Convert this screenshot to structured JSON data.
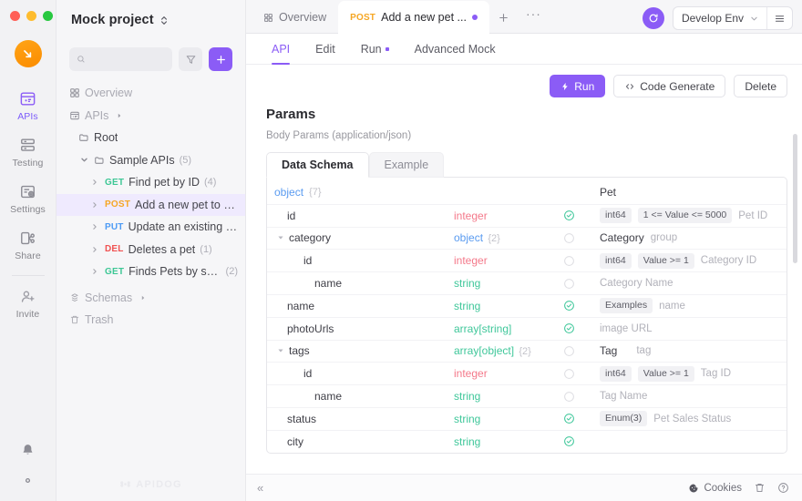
{
  "rail": {
    "brand_icon": "apidog-logo-icon",
    "items": [
      {
        "label": "APIs",
        "icon": "apis-icon",
        "active": true
      },
      {
        "label": "Testing",
        "icon": "testing-icon",
        "active": false
      },
      {
        "label": "Settings",
        "icon": "settings-icon",
        "active": false
      },
      {
        "label": "Share",
        "icon": "share-icon",
        "active": false
      },
      {
        "label": "Invite",
        "icon": "invite-icon",
        "active": false
      }
    ],
    "bottom_icons": [
      "bell-icon",
      "gear-icon"
    ]
  },
  "sidebar": {
    "project_title": "Mock project",
    "project_switcher_icon": "chevron-updown-icon",
    "search": {
      "value": "",
      "placeholder": "",
      "icon": "search-icon"
    },
    "filter_icon": "filter-icon",
    "add_label": "+",
    "overview_label": "Overview",
    "apis_label": "APIs",
    "root_label": "Root",
    "sample_apis": {
      "label": "Sample APIs",
      "count": "(5)"
    },
    "endpoints": [
      {
        "method": "GET",
        "name": "Find pet by ID",
        "count": "(4)",
        "selected": false
      },
      {
        "method": "POST",
        "name": "Add a new pet to the s...",
        "count": "",
        "selected": true
      },
      {
        "method": "PUT",
        "name": "Update an existing pet...",
        "count": "",
        "selected": false
      },
      {
        "method": "DEL",
        "name": "Deletes a pet",
        "count": "(1)",
        "selected": false
      },
      {
        "method": "GET",
        "name": "Finds Pets by status",
        "count": "(2)",
        "selected": false
      }
    ],
    "schemas_label": "Schemas",
    "trash_label": "Trash",
    "watermark": "APIDOG"
  },
  "tabbar": {
    "tabs": [
      {
        "label": "Overview",
        "method": "",
        "active": false,
        "icon": "grid-icon",
        "dirty": false
      },
      {
        "label": "Add a new pet ...",
        "method": "POST",
        "active": true,
        "icon": "",
        "dirty": true
      }
    ],
    "new_tab_label": "+",
    "more_label": "···",
    "sync_icon": "sync-icon",
    "env_name": "Develop Env",
    "env_chevron_icon": "chevron-down-icon",
    "env_menu_icon": "hamburger-icon"
  },
  "content": {
    "subtabs": [
      {
        "label": "API",
        "active": true,
        "dot": false
      },
      {
        "label": "Edit",
        "active": false,
        "dot": false
      },
      {
        "label": "Run",
        "active": false,
        "dot": true
      },
      {
        "label": "Advanced Mock",
        "active": false,
        "dot": false
      }
    ],
    "actions": [
      {
        "label": "Run",
        "icon": "lightning-icon",
        "primary": true
      },
      {
        "label": "Code Generate",
        "icon": "code-icon",
        "primary": false
      },
      {
        "label": "Delete",
        "icon": "",
        "primary": false
      }
    ],
    "params_title": "Params",
    "body_params_label": "Body Params (application/json)",
    "schema_tabs": [
      {
        "label": "Data Schema",
        "active": true
      },
      {
        "label": "Example",
        "active": false
      }
    ],
    "schema_rows": [
      {
        "indent": 0,
        "caret": "",
        "name": "object",
        "name_kind": "type-object",
        "braces": "{7}",
        "type": "",
        "type_kind": "",
        "required": "none",
        "meta_strong": "Pet",
        "chips": [],
        "desc": ""
      },
      {
        "indent": 1,
        "caret": "",
        "name": "id",
        "name_kind": "field",
        "braces": "",
        "type": "integer",
        "type_kind": "integer",
        "required": "yes",
        "meta_strong": "",
        "chips": [
          "int64",
          "1 <= Value <= 5000"
        ],
        "desc": "Pet ID"
      },
      {
        "indent": 1,
        "caret": "down",
        "name": "category",
        "name_kind": "field",
        "braces": "",
        "type": "object",
        "type_kind": "object",
        "braces2": "{2}",
        "required": "no",
        "meta_strong": "Category",
        "chips": [],
        "desc": "group"
      },
      {
        "indent": 2,
        "caret": "",
        "name": "id",
        "name_kind": "field",
        "braces": "",
        "type": "integer",
        "type_kind": "integer",
        "required": "no",
        "meta_strong": "",
        "chips": [
          "int64",
          "Value >= 1"
        ],
        "desc": "Category ID"
      },
      {
        "indent": 2,
        "caret": "",
        "name": "name",
        "name_kind": "field",
        "braces": "",
        "type": "string",
        "type_kind": "string",
        "required": "no",
        "meta_strong": "",
        "chips": [],
        "desc": "Category Name"
      },
      {
        "indent": 1,
        "caret": "",
        "name": "name",
        "name_kind": "field",
        "braces": "",
        "type": "string",
        "type_kind": "string",
        "required": "yes",
        "meta_strong": "",
        "chips": [
          "Examples"
        ],
        "desc": "name"
      },
      {
        "indent": 1,
        "caret": "",
        "name": "photoUrls",
        "name_kind": "field",
        "braces": "",
        "type": "array[string]",
        "type_kind": "array",
        "required": "yes",
        "meta_strong": "",
        "chips": [],
        "desc": "image URL"
      },
      {
        "indent": 1,
        "caret": "down",
        "name": "tags",
        "name_kind": "field",
        "braces": "",
        "type": "array[object]",
        "type_kind": "array",
        "braces2": "{2}",
        "required": "no",
        "meta_strong": "Tag",
        "chips": [],
        "desc": "tag"
      },
      {
        "indent": 2,
        "caret": "",
        "name": "id",
        "name_kind": "field",
        "braces": "",
        "type": "integer",
        "type_kind": "integer",
        "required": "no",
        "meta_strong": "",
        "chips": [
          "int64",
          "Value >= 1"
        ],
        "desc": "Tag ID"
      },
      {
        "indent": 2,
        "caret": "",
        "name": "name",
        "name_kind": "field",
        "braces": "",
        "type": "string",
        "type_kind": "string",
        "required": "no",
        "meta_strong": "",
        "chips": [],
        "desc": "Tag Name"
      },
      {
        "indent": 1,
        "caret": "",
        "name": "status",
        "name_kind": "field",
        "braces": "",
        "type": "string",
        "type_kind": "string",
        "required": "yes",
        "meta_strong": "",
        "chips": [
          "Enum(3)"
        ],
        "desc": "Pet Sales Status"
      },
      {
        "indent": 1,
        "caret": "",
        "name": "city",
        "name_kind": "field",
        "braces": "",
        "type": "string",
        "type_kind": "string",
        "required": "yes",
        "meta_strong": "",
        "chips": [],
        "desc": ""
      }
    ]
  },
  "footer": {
    "collapse_label": "«",
    "cookies_label": "Cookies",
    "cookies_icon": "cookie-icon",
    "trash_icon": "trash-icon",
    "help_icon": "help-circle-icon"
  },
  "colors": {
    "accent": "#8b5cf6",
    "method_get": "#3dc795",
    "method_post": "#f5a623",
    "method_put": "#4d9bf5",
    "method_del": "#f05252",
    "type_object": "#5a9bf0",
    "type_integer": "#f4798a",
    "type_string": "#3fc79a",
    "required_check": "#3fc79a"
  }
}
